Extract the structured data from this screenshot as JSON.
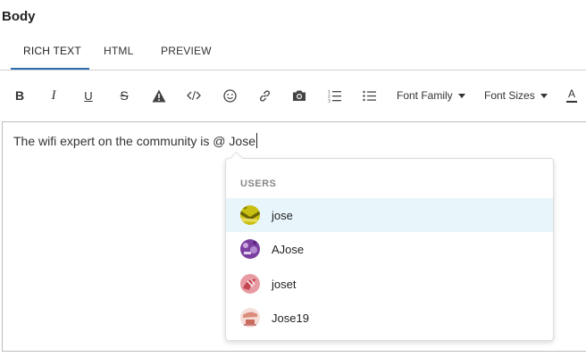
{
  "header": {
    "title": "Body"
  },
  "tabs": [
    {
      "label": "RICH TEXT",
      "active": true
    },
    {
      "label": "HTML"
    },
    {
      "label": "PREVIEW"
    }
  ],
  "toolbar": {
    "bold": "B",
    "italic": "I",
    "underline": "U",
    "strike": "S",
    "font_family": "Font Family",
    "font_sizes": "Font Sizes",
    "font_color": "A"
  },
  "editor": {
    "text": "The wifi expert on the community is @ Jose"
  },
  "mentions": {
    "header": "USERS",
    "users": [
      {
        "name": "jose",
        "selected": true
      },
      {
        "name": "AJose"
      },
      {
        "name": "joset"
      },
      {
        "name": "Jose19"
      }
    ]
  },
  "colors": {
    "accent": "#2f6fb0",
    "selected_row": "#e8f6fb"
  }
}
